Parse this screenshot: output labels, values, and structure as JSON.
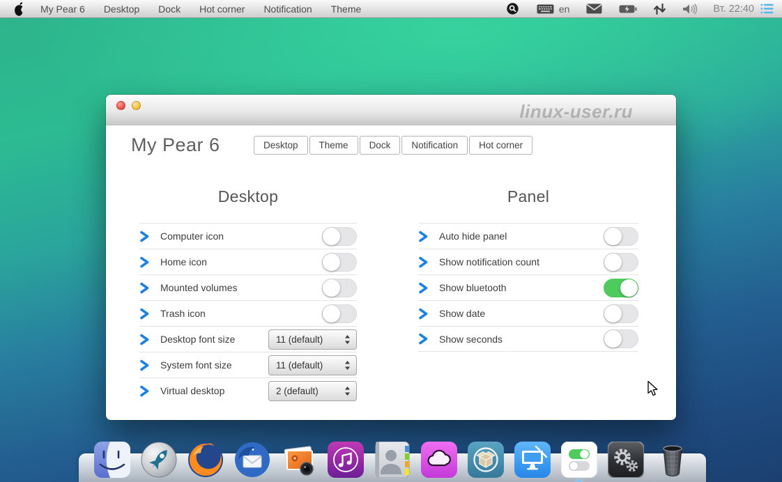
{
  "menubar": {
    "logo": "pear-logo",
    "items": [
      "My Pear 6",
      "Desktop",
      "Dock",
      "Hot corner",
      "Notification",
      "Theme"
    ],
    "status": {
      "input_language": "en",
      "clock": "Вт. 22:40",
      "icons": [
        "search",
        "keyboard",
        "mail",
        "battery-charging",
        "updown-arrows",
        "volume",
        "menu-list"
      ]
    }
  },
  "window": {
    "app_title": "My Pear 6",
    "watermark": "linux-user.ru",
    "traffic_lights": [
      "close",
      "minimize"
    ],
    "tabs": [
      {
        "label": "Desktop"
      },
      {
        "label": "Theme"
      },
      {
        "label": "Dock"
      },
      {
        "label": "Notification"
      },
      {
        "label": "Hot corner"
      }
    ],
    "columns": [
      {
        "heading": "Desktop",
        "rows": [
          {
            "label": "Computer icon",
            "control": "toggle",
            "state": "off"
          },
          {
            "label": "Home icon",
            "control": "toggle",
            "state": "off"
          },
          {
            "label": "Mounted volumes",
            "control": "toggle",
            "state": "off"
          },
          {
            "label": "Trash icon",
            "control": "toggle",
            "state": "off"
          },
          {
            "label": "Desktop font size",
            "control": "select",
            "value": "11 (default)"
          },
          {
            "label": "System font size",
            "control": "select",
            "value": "11 (default)"
          },
          {
            "label": "Virtual desktop",
            "control": "select",
            "value": "2 (default)"
          }
        ]
      },
      {
        "heading": "Panel",
        "rows": [
          {
            "label": "Auto hide panel",
            "control": "toggle",
            "state": "off"
          },
          {
            "label": "Show notification count",
            "control": "toggle",
            "state": "off"
          },
          {
            "label": "Show bluetooth",
            "control": "toggle",
            "state": "on"
          },
          {
            "label": "Show date",
            "control": "toggle",
            "state": "off"
          },
          {
            "label": "Show seconds",
            "control": "toggle",
            "state": "off"
          }
        ]
      }
    ]
  },
  "dock": {
    "items": [
      {
        "name": "file-manager"
      },
      {
        "name": "launcher-rocket"
      },
      {
        "name": "firefox"
      },
      {
        "name": "thunderbird"
      },
      {
        "name": "photos"
      },
      {
        "name": "music"
      },
      {
        "name": "contacts"
      },
      {
        "name": "cloud"
      },
      {
        "name": "cydia"
      },
      {
        "name": "display"
      },
      {
        "name": "preferences-toggles",
        "running": true
      },
      {
        "name": "system-tools"
      },
      {
        "name": "trash"
      }
    ]
  },
  "colors": {
    "accent_blue": "#1b82e3",
    "toggle_on_green": "#4ecb5c",
    "menubar_list_icon": "#56b7ea",
    "wallpaper_top": "#2cbb92",
    "wallpaper_bottom": "#1b4070"
  }
}
